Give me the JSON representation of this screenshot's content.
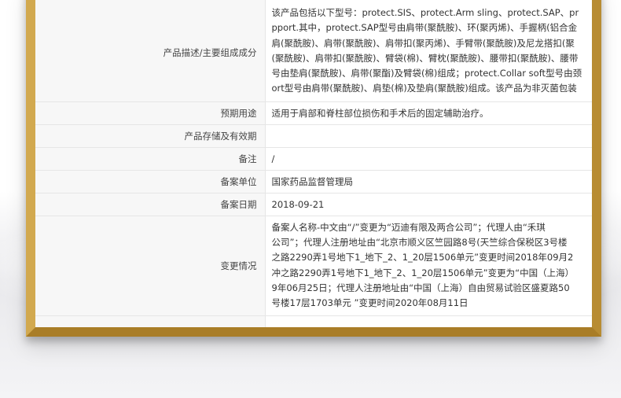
{
  "product_info": {
    "rows": [
      {
        "label": "产品描述/主要组成成分",
        "lines": [
          "该产品包括以下型号：protect.SIS、protect.Arm sling、protect.SAP、pr",
          "pport.其中，protect.SAP型号由肩带(聚酰胺)、环(聚丙烯)、手握柄(铝合金",
          "肩(聚酰胺)、肩带(聚酰胺)、肩带扣(聚丙烯)、手臂带(聚酰胺)及尼龙搭扣(聚",
          "(聚酰胺)、肩带扣(聚酰胺)、臂袋(棉)、臂枕(聚酰胺)、腰带扣(聚酰胺)、腰带",
          "号由垫肩(聚酰胺)、肩带(聚酯)及臂袋(棉)组成；protect.Collar soft型号由颈",
          "ort型号由肩带(聚酰胺)、肩垫(棉)及垫肩(聚酰胺)组成。该产品为非灭菌包装"
        ]
      },
      {
        "label": "预期用途",
        "value": "适用于肩部和脊柱部位损伤和手术后的固定辅助治疗。"
      },
      {
        "label": "产品存储及有效期",
        "value": ""
      },
      {
        "label": "备注",
        "value": "/"
      },
      {
        "label": "备案单位",
        "value": "国家药品监督管理局"
      },
      {
        "label": "备案日期",
        "value": "2018-09-21"
      },
      {
        "label": "变更情况",
        "lines": [
          "备案人名称-中文由“/”变更为“迈迪有限及两合公司”；代理人由“禾琪",
          "公司”；代理人注册地址由“北京市顺义区竺园路8号(天竺综合保税区3号楼",
          "之路2290弄1号地下1_地下_2、1_20层1506单元”变更时间2018年09月2",
          "冲之路2290弄1号地下1_地下_2、1_20层1506单元”变更为“中国（上海）",
          "9年06月25日；代理人注册地址由“中国（上海）自由贸易试验区盛夏路50",
          "号楼17层1703单元 ”变更时间2020年08月11日"
        ]
      },
      {
        "label": "",
        "value": ""
      }
    ]
  },
  "colors": {
    "frame_gold": "#c9a044",
    "label_bg": "#f7f7f7",
    "border": "#e6e6e6",
    "text": "#333333"
  }
}
